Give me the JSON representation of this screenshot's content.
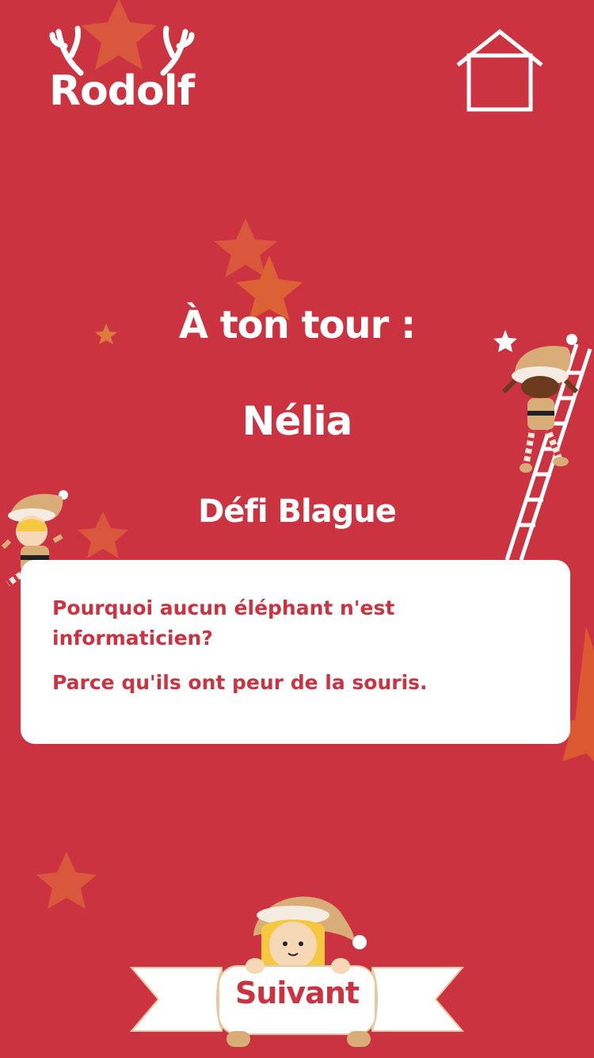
{
  "header": {
    "logo_text": "Rodolf",
    "home_icon": "home-icon"
  },
  "main": {
    "turn_label": "À ton tour :",
    "player_name": "Nélia",
    "challenge_type": "Défi Blague"
  },
  "card": {
    "question": "Pourquoi aucun éléphant n'est informaticien?",
    "answer": "Parce qu'ils ont peur de la souris."
  },
  "footer": {
    "next_label": "Suivant"
  },
  "colors": {
    "background": "#cc3340",
    "star": "#e0593a",
    "card": "#ffffff",
    "text_accent": "#cc3340"
  }
}
